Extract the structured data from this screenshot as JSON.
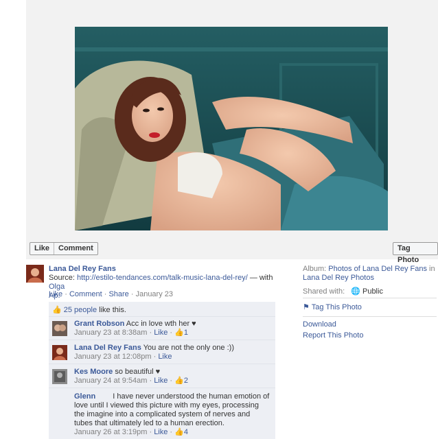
{
  "photo_alt": "Lana Del Rey portrait",
  "actions": {
    "like": "Like",
    "comment": "Comment",
    "tag_photo": "Tag Photo"
  },
  "post": {
    "page_name": "Lana Del Rey Fans",
    "source_prefix": "Source: ",
    "source_url": "http://estilo-tendances.com/talk-music-lana-del-rey/",
    "with_text": " — with ",
    "with_name_1": "Olga",
    "with_name_2": "Ap.",
    "meta_like": "Like",
    "meta_comment": "Comment",
    "meta_share": "Share",
    "meta_date": "January 23",
    "sep": " · "
  },
  "likes": {
    "count_link": "25 people",
    "suffix": " like this."
  },
  "comments": [
    {
      "author": "Grant Robson",
      "text": "Acc in love wth her ♥",
      "time": "January 23 at 8:38am",
      "like": "Like",
      "likes": "1"
    },
    {
      "author": "Lana Del Rey Fans",
      "text": "You are not the only one :))",
      "time": "January 23 at 12:08pm",
      "like": "Like",
      "likes": ""
    },
    {
      "author": "Kes Moore",
      "text": "so beautiful ♥",
      "time": "January 24 at 9:54am",
      "like": "Like",
      "likes": "2"
    },
    {
      "author": "Glenn",
      "text": "I have never understood the human emotion of love until I viewed this picture with my eyes, processing the imagine into a complicated system of nerves and tubes that ultimately led to a human erection.",
      "time": "January 26 at 3:19pm",
      "like": "Like",
      "likes": "4"
    }
  ],
  "sidebar": {
    "album_label": "Album: ",
    "album_link_1": "Photos of Lana Del Rey Fans",
    "album_in": " in",
    "album_link_2": "Lana Del Rey Photos",
    "shared_label": "Shared with:",
    "shared_value": "Public",
    "tag_this_photo": "Tag This Photo",
    "download": "Download",
    "report": "Report This Photo"
  },
  "colors": {
    "link": "#3b5998",
    "comment_bg": "#edeff4",
    "stage_bg": "#f2f2f2"
  }
}
